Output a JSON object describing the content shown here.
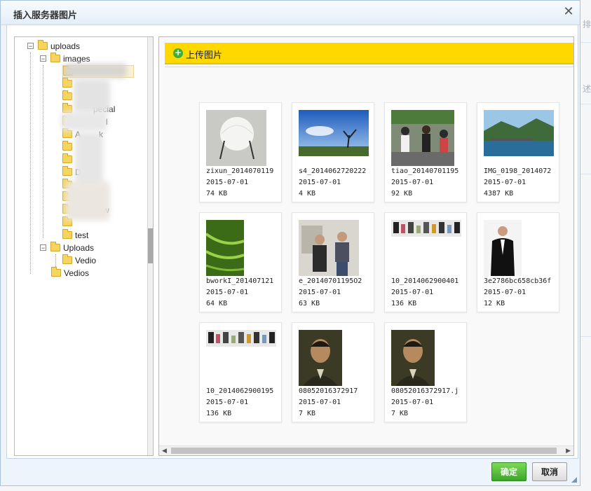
{
  "dialog": {
    "title": "插入服务器图片",
    "close_glyph": "✕"
  },
  "background": {
    "texts": [
      "述",
      "排"
    ]
  },
  "tree": {
    "uploads": "uploads",
    "images": "images",
    "partial_labels": [
      "pecial",
      "l",
      "A",
      "k",
      "n",
      "er",
      "D",
      "s",
      "c",
      "w"
    ],
    "test": "test",
    "Uploads": "Uploads",
    "Vedio": "Vedio",
    "Vedios": "Vedios",
    "toggle_minus": "−"
  },
  "toolbar": {
    "upload_label": "上传图片",
    "upload_glyph": "+"
  },
  "files": [
    {
      "name": "zixun_2014070119",
      "date": "2015-07-01",
      "size": "74 KB",
      "kind": "lamp"
    },
    {
      "name": "s4_2014062720222",
      "date": "2015-07-01",
      "size": "4 KB",
      "kind": "sky"
    },
    {
      "name": "tiao_20140701195",
      "date": "2015-07-01",
      "size": "92 KB",
      "kind": "crowd"
    },
    {
      "name": "IMG_0198_2014072",
      "date": "2015-07-01",
      "size": "4387 KB",
      "kind": "lake"
    },
    {
      "name": "bworkI_201407121",
      "date": "2015-07-01",
      "size": "64 KB",
      "kind": "green"
    },
    {
      "name": "e_20140701195O2",
      "date": "2015-07-01",
      "size": "63 KB",
      "kind": "people"
    },
    {
      "name": "10_2014062900401",
      "date": "2015-07-01",
      "size": "136 KB",
      "kind": "shelf"
    },
    {
      "name": "3e2786bc658cb36f",
      "date": "2015-07-01",
      "size": "12 KB",
      "kind": "tux"
    },
    {
      "name": "10_2014062900195",
      "date": "2015-07-01",
      "size": "136 KB",
      "kind": "shelf"
    },
    {
      "name": "08052016372917",
      "date": "2015-07-01",
      "size": "7 KB",
      "kind": "portrait"
    },
    {
      "name": "08052016372917.j",
      "date": "2015-07-01",
      "size": "7 KB",
      "kind": "portrait"
    }
  ],
  "scrollbar": {
    "left_arrow": "◀",
    "right_arrow": "▶"
  },
  "footer": {
    "ok_label": "确定",
    "cancel_label": "取消"
  }
}
